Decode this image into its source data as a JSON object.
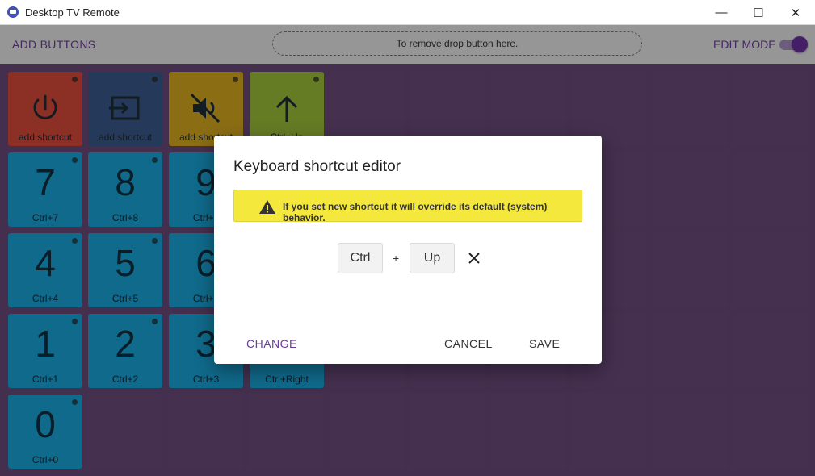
{
  "window": {
    "title": "Desktop TV Remote",
    "minimize": "—",
    "maximize": "☐",
    "close": "✕"
  },
  "toolbar": {
    "add_buttons": "ADD BUTTONS",
    "drop_zone": "To remove drop button here.",
    "edit_mode": "EDIT MODE",
    "edit_mode_on": true
  },
  "tiles": [
    {
      "label": "add shortcut",
      "icon": "power-icon",
      "color": "#d84a3a"
    },
    {
      "label": "add shortcut",
      "icon": "input-icon",
      "color": "#3a5a8a"
    },
    {
      "label": "add shortcut",
      "icon": "mute-icon",
      "color": "#d6a81f"
    },
    {
      "label": "Ctrl+Up",
      "icon": "arrow-up-icon",
      "color": "#9bbf3a"
    },
    {
      "big": "7",
      "label": "Ctrl+7"
    },
    {
      "big": "8",
      "label": "Ctrl+8"
    },
    {
      "big": "9",
      "label": "Ctrl+9"
    },
    {
      "big": "4",
      "label": "Ctrl+4"
    },
    {
      "big": "5",
      "label": "Ctrl+5"
    },
    {
      "big": "6",
      "label": "Ctrl+6"
    },
    {
      "big": "1",
      "label": "Ctrl+1"
    },
    {
      "big": "2",
      "label": "Ctrl+2"
    },
    {
      "big": "3",
      "label": "Ctrl+3"
    },
    {
      "big": "",
      "label": "Ctrl+Right"
    },
    {
      "big": "0",
      "label": "Ctrl+0"
    }
  ],
  "dialog": {
    "title": "Keyboard shortcut editor",
    "warning": "If you set new shortcut it will override its default (system) behavior.",
    "key1": "Ctrl",
    "plus": "+",
    "key2": "Up",
    "change": "CHANGE",
    "cancel": "CANCEL",
    "save": "SAVE"
  },
  "colors": {
    "accent": "#6a3d99",
    "numpad": "#1aa3d6",
    "warning": "#f4e83c"
  }
}
